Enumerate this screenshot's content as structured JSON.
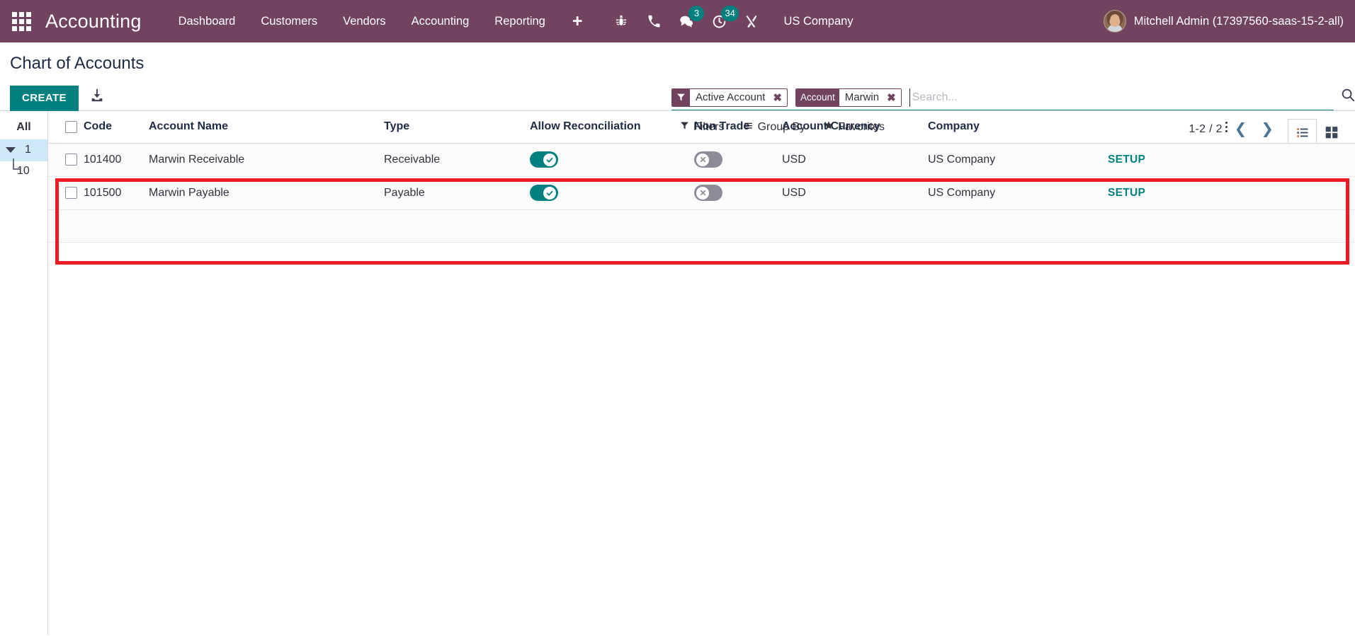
{
  "navbar": {
    "apps_icon": "apps-grid-icon",
    "brand": "Accounting",
    "menu": [
      {
        "label": "Dashboard"
      },
      {
        "label": "Customers"
      },
      {
        "label": "Vendors"
      },
      {
        "label": "Accounting"
      },
      {
        "label": "Reporting"
      },
      {
        "label": "+"
      }
    ],
    "sys_icons": [
      {
        "name": "bug-icon",
        "badge": null
      },
      {
        "name": "phone-icon",
        "badge": null
      },
      {
        "name": "messages-icon",
        "badge": "3"
      },
      {
        "name": "activities-clock-icon",
        "badge": "34"
      },
      {
        "name": "tools-icon",
        "badge": null
      }
    ],
    "company": "US Company",
    "user": "Mitchell Admin (17397560-saas-15-2-all)",
    "bg_color": "#71435f",
    "badge_color": "#00807e"
  },
  "control_panel": {
    "title": "Chart of Accounts",
    "create_label": "CREATE",
    "create_color": "#00807e",
    "import_icon": "import-download-icon",
    "search": {
      "placeholder": "Search...",
      "value": "",
      "search_icon": "search-magnifier-icon",
      "facets": [
        {
          "tag_icon": "filter-funnel-icon",
          "tag_label": "",
          "value": "Active Account",
          "remove": "✖"
        },
        {
          "tag_icon": "",
          "tag_label": "Account",
          "value": "Marwin",
          "remove": "✖"
        }
      ]
    },
    "filters": [
      {
        "label": "Filters",
        "icon": "filter-funnel-icon"
      },
      {
        "label": "Group By",
        "icon": "group-by-bars-icon"
      },
      {
        "label": "Favorites",
        "icon": "star-icon"
      }
    ],
    "pager": {
      "count": "1-2 / 2",
      "prev_icon": "chevron-left-icon",
      "next_icon": "chevron-right-icon"
    },
    "views": [
      {
        "name": "list-view",
        "icon": "list-view-icon",
        "active": true
      },
      {
        "name": "kanban-view",
        "icon": "kanban-view-icon",
        "active": false
      }
    ]
  },
  "sidebar": {
    "all_label": "All",
    "node_label": "1",
    "child_label": "10"
  },
  "table": {
    "columns": [
      {
        "key": "checkbox",
        "label": ""
      },
      {
        "key": "code",
        "label": "Code"
      },
      {
        "key": "name",
        "label": "Account Name"
      },
      {
        "key": "type",
        "label": "Type"
      },
      {
        "key": "reconciliation",
        "label": "Allow Reconciliation"
      },
      {
        "key": "non_trade",
        "label": "Non Trade"
      },
      {
        "key": "currency",
        "label": "Account Currency"
      },
      {
        "key": "company",
        "label": "Company"
      },
      {
        "key": "setup",
        "label": ""
      }
    ],
    "optional_columns_icon": "kebab-menu-icon",
    "rows": [
      {
        "code": "101400",
        "name": "Marwin Receivable",
        "type": "Receivable",
        "reconciliation": true,
        "non_trade": false,
        "currency": "USD",
        "company": "US Company",
        "setup": "SETUP"
      },
      {
        "code": "101500",
        "name": "Marwin Payable",
        "type": "Payable",
        "reconciliation": true,
        "non_trade": false,
        "currency": "USD",
        "company": "US Company",
        "setup": "SETUP"
      }
    ]
  },
  "annotation": {
    "type": "red-rectangle-highlight",
    "color": "#ec1c24"
  }
}
